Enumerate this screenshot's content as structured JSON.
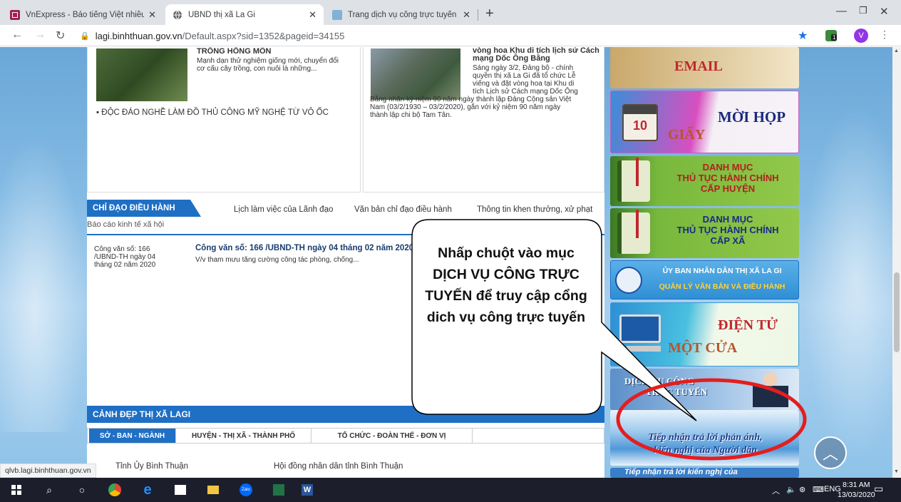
{
  "browser": {
    "tabs": [
      {
        "title": "VnExpress - Báo tiếng Việt nhiều",
        "icon": "vnexpress-favicon"
      },
      {
        "title": "UBND thị xã La Gi",
        "icon": "globe-favicon"
      },
      {
        "title": "Trang dịch vụ công trực tuyến",
        "icon": "page-favicon"
      }
    ],
    "new_tab": "+",
    "url_host": "lagi.binhthuan.gov.vn",
    "url_path": "/Default.aspx?sid=1352&pageid=34155",
    "profile_initial": "V",
    "ext_badge": "1"
  },
  "news": {
    "left": {
      "title_cut": "TRỒNG HỒNG MÔN",
      "desc": "Mạnh dạn thử nghiệm giống mới, chuyển đổi cơ cấu cây trồng, con nuôi là những...",
      "bullet": "ĐỘC ĐÁO NGHỀ LÀM ĐỒ THỦ CÔNG MỸ NGHỆ TỪ VỎ ỐC"
    },
    "right": {
      "title_cut": "vòng hoa Khu di tích lịch sử Cách mạng Dốc Ông Bằng",
      "desc_lines": [
        "Sáng ngày 3/2, Đảng bộ - chính",
        "quyền thị xã La Gi đã tổ chức Lễ",
        "viếng và đặt vòng hoa tại Khu di",
        "tích Lịch sử Cách mạng Dốc Ông"
      ],
      "desc_full": [
        "Bằng nhân kỷ niệm 90 năm ngày thành lập Đảng Cộng sản Việt",
        "Nam (03/2/1930 – 03/2/2020), gắn với kỷ niệm 90 năm ngày",
        "thành lập chi bộ Tam Tân."
      ]
    }
  },
  "chidao": {
    "tab": "CHỈ ĐẠO ĐIỀU HÀNH",
    "links": [
      "Lịch làm việc của Lãnh đạo",
      "Văn bản chỉ đạo điều hành",
      "Thông tin khen thưởng, xử phạt"
    ],
    "link2": "Báo cáo kinh tế xã hội",
    "doc_alt": [
      "Công văn số: 166",
      "/UBND-TH ngày 04",
      "tháng 02 năm 2020"
    ],
    "doc_title": "Công văn số: 166 /UBND-TH ngày 04 tháng 02 năm 2020",
    "doc_desc": "V/v tham mưu tăng cường công tác phòng, chống..."
  },
  "canhdep": {
    "title": "CẢNH ĐẸP THỊ XÃ LAGI",
    "tabs": [
      "SỞ - BAN - NGÀNH",
      "HUYỆN - THỊ XÃ - THÀNH PHỐ",
      "TỔ CHỨC - ĐOÀN THỂ - ĐƠN VỊ"
    ],
    "links": [
      "Tỉnh Ủy Bình Thuận",
      "Hội đồng nhân dân tỉnh Bình Thuận"
    ]
  },
  "banners": {
    "email": "EMAIL",
    "moihop_1": "MỜI HỌP",
    "moihop_2": "GIẤY",
    "calendar_day": "10",
    "tthc_huyen": [
      "DANH MỤC",
      "THỦ TỤC HÀNH CHÍNH",
      "CẤP HUYỆN"
    ],
    "tthc_xa": [
      "DANH MỤC",
      "THỦ TỤC HÀNH CHÍNH",
      "CẤP XÃ"
    ],
    "ubnd": [
      "ỦY BAN NHÂN DÂN THỊ XÃ LA GI",
      "QUẢN LÝ VĂN BẢN VÀ ĐIỀU HÀNH"
    ],
    "motcua": [
      "ĐIỆN TỬ",
      "MỘT CỬA"
    ],
    "dvc": [
      "DỊCH VỤ CÔNG",
      "TRỰC TUYẾN"
    ],
    "phananh": [
      "Tiếp nhận trả lời phản ánh,",
      "kiến nghị của Người dân"
    ],
    "bottom_cut": "Tiếp nhận trả lời kiến nghị của"
  },
  "callout": "Nhấp chuột vào mục DỊCH VỤ CÔNG TRỰC TUYẾN để truy cập cổng dich vụ công trực tuyến",
  "status_url": "qlvb.lagi.binhthuan.gov.vn",
  "taskbar": {
    "time": "8:31 AM",
    "date": "13/03/2020",
    "lang": "ENG",
    "zalo": "Zalo"
  },
  "colors": {
    "accent_blue": "#1f6fc5",
    "callout_red": "#e41e1e"
  }
}
